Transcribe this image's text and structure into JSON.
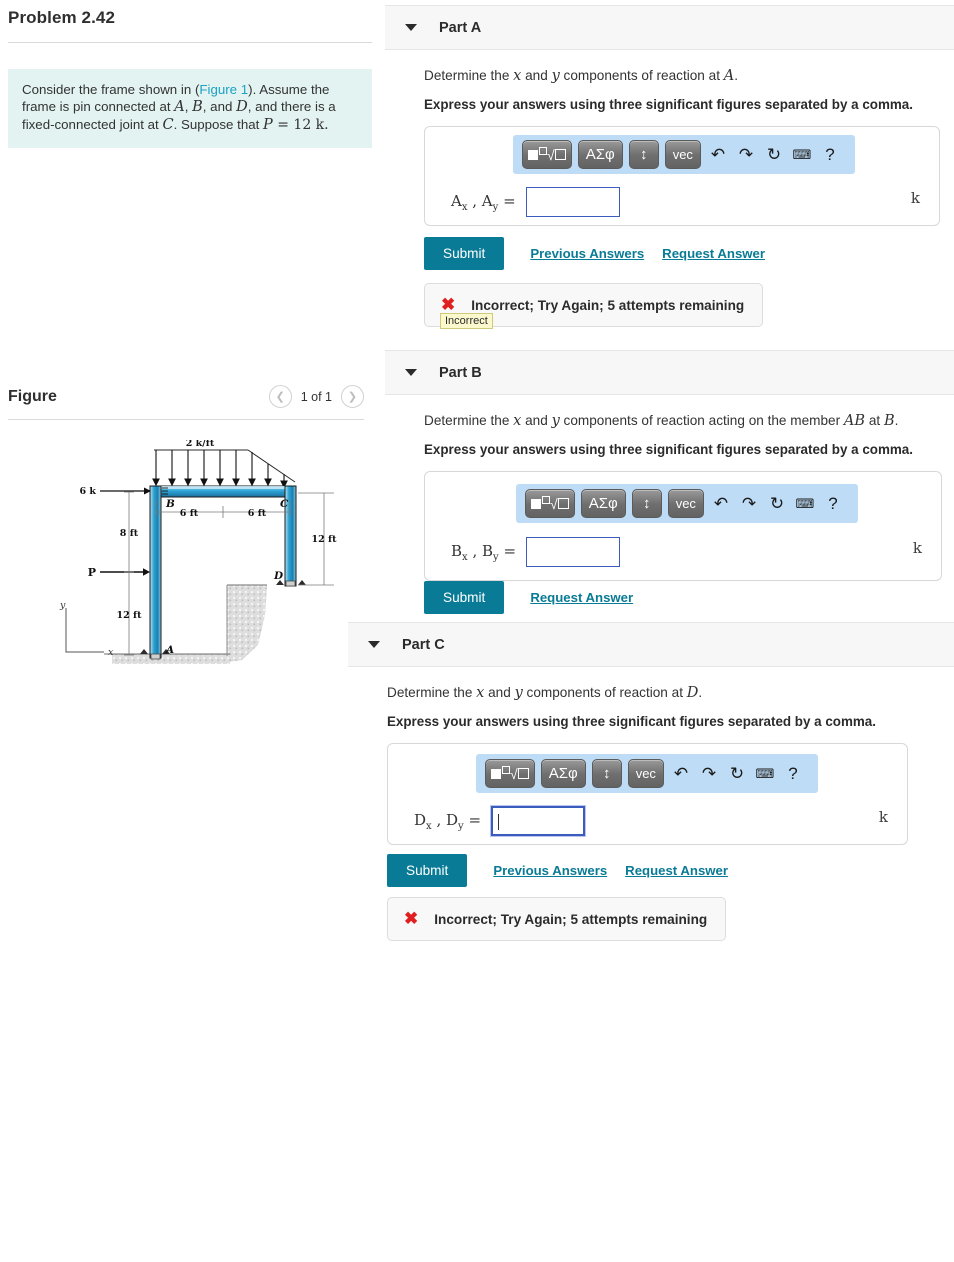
{
  "problem": {
    "title": "Problem 2.42",
    "statement_parts": {
      "t1": "Consider the frame shown in (",
      "link": "Figure 1",
      "t2": "). Assume the frame is pin connected at ",
      "A": "A",
      "t3": ", ",
      "B": "B",
      "t4": ", and ",
      "D": "D",
      "t5": ", and there is a fixed-connected joint at ",
      "C": "C",
      "t6": ". Suppose that ",
      "P": "P",
      "t7": " = 12 k."
    }
  },
  "figure": {
    "heading": "Figure",
    "prev_icon": "chevron-left-icon",
    "next_icon": "chevron-right-icon",
    "counter": "1 of 1",
    "labels": {
      "dist_load": "2 k/ft",
      "force_6k": "6 k",
      "force_P": "P",
      "dim_8ft": "8 ft",
      "dim_12ft_left": "12 ft",
      "dim_12ft_right": "12 ft",
      "dim_6ft_a": "6 ft",
      "dim_6ft_b": "6 ft",
      "pt_A": "A",
      "pt_B": "B",
      "pt_C": "C",
      "pt_D": "D",
      "axis_x": "x",
      "axis_y": "y"
    }
  },
  "toolbar": {
    "template_icon": "math-template-icon",
    "greek_label": "ΑΣφ",
    "updown_label": "↕",
    "vec_label": "vec",
    "undo_icon": "undo-icon",
    "redo_icon": "redo-icon",
    "reset_icon": "reset-icon",
    "keyboard_icon": "keyboard-icon",
    "help_label": "?"
  },
  "common": {
    "express_note": "Express your answers using three significant figures separated by a comma.",
    "submit_label": "Submit",
    "previous_answers_label": "Previous Answers",
    "request_answer_label": "Request Answer",
    "unit": "k",
    "incorrect_message": "Incorrect; Try Again; 5 attempts remaining",
    "incorrect_tooltip": "Incorrect",
    "caret_icon": "caret-down-icon",
    "x-icon": "x-mark-icon"
  },
  "parts": [
    {
      "id": "A",
      "header": "Part A",
      "question_prefix": "Determine the ",
      "var_x": "x",
      "question_mid": " and ",
      "var_y": "y",
      "question_suffix": " components of reaction at ",
      "target": "A",
      "period": ".",
      "answer_label_main": "A",
      "answer_label_sub1": "x",
      "answer_label_sub2": "y",
      "answer_value": "",
      "has_previous_answers": true,
      "has_feedback": true,
      "has_tooltip": true,
      "input_focused": false
    },
    {
      "id": "B",
      "header": "Part B",
      "question_prefix": "Determine the ",
      "var_x": "x",
      "question_mid": " and ",
      "var_y": "y",
      "question_suffix": " components of reaction acting on the member ",
      "member": "AB",
      "question_suffix2": " at ",
      "target": "B",
      "period": ".",
      "answer_label_main": "B",
      "answer_label_sub1": "x",
      "answer_label_sub2": "y",
      "answer_value": "",
      "has_previous_answers": false,
      "has_feedback": false,
      "has_tooltip": false,
      "input_focused": false
    },
    {
      "id": "C",
      "header": "Part C",
      "question_prefix": "Determine the ",
      "var_x": "x",
      "question_mid": " and ",
      "var_y": "y",
      "question_suffix": " components of reaction at ",
      "target": "D",
      "period": ".",
      "answer_label_main": "D",
      "answer_label_sub1": "x",
      "answer_label_sub2": "y",
      "answer_value": "",
      "has_previous_answers": true,
      "has_feedback": true,
      "has_tooltip": false,
      "input_focused": true
    }
  ],
  "colors": {
    "accent": "#0a7b96",
    "info_box": "#e2f3f1",
    "link": "#1ba2c4",
    "error": "#e02020",
    "mathbar": "#bedcf5"
  }
}
